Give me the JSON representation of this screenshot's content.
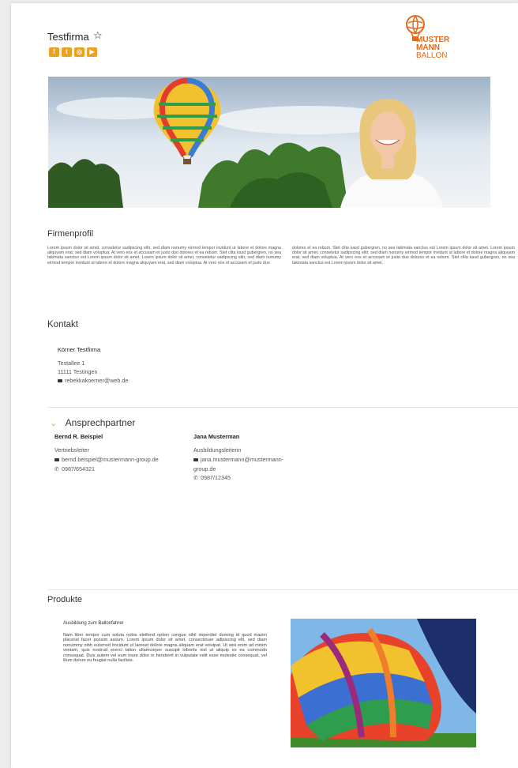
{
  "header": {
    "company_name": "Testfirma",
    "star_icon": "star-outline-icon",
    "social_icons": [
      "facebook-icon",
      "twitter-icon",
      "instagram-icon",
      "youtube-icon"
    ],
    "logo": {
      "line1": "MUSTER",
      "line2": "MANN",
      "line3": "BALLON",
      "brand_color": "#e06b1c"
    }
  },
  "accent_color": "#f0a020",
  "profile": {
    "title": "Firmenprofil",
    "col1": "Lorem ipsum dolor sit amet, consetetur sadipscing elitr, sed diam nonumy eirmod tempor invidunt ut labore et dolore magna aliquyam erat, sed diam voluptua. At vero eos et accusam et justo duo dolores et ea rebum. Stet clita kasd gubergren, no sea takimata sanctus est Lorem ipsum dolor sit amet. Lorem ipsum dolor sit amet, consetetur sadipscing elitr, sed diam nonumy eirmod tempor invidunt ut labore et dolore magna aliquyam erat, sed diam voluptua. At vero eos et accusam et justo duo",
    "col2": "dolores et ea rebum. Stet clita kasd gubergren, no sea takimata sanctus est Lorem ipsum dolor sit amet. Lorem ipsum dolor sit amet, consetetur sadipscing elitr, sed diam nonumy eirmod tempor invidunt ut labore et dolore magna aliquyam erat, sed diam voluptua. At vero eos et accusam et justo duo dolores et ea rebum. Stet clita kasd gubergren, no sea takimata sanctus est Lorem ipsum dolor sit amet."
  },
  "kontakt": {
    "title": "Kontakt",
    "name": "Körner Testfirma",
    "street": "Testallee 1",
    "city": "11111 Testingen",
    "email": "rebekkakoerner@web.de"
  },
  "ansprechpartner": {
    "title": "Ansprechpartner",
    "persons": [
      {
        "name": "Bernd R. Beispiel",
        "role": "Vertriebsleiter",
        "email": "bernd.beispiel@mustermann-group.de",
        "phone": "0987/654321"
      },
      {
        "name": "Jana Musterman",
        "role": "Ausbildungsleiterin",
        "email_line1": "jana.mustermann@mustermann-",
        "email_line2": "group.de",
        "phone": "0987/12345"
      }
    ]
  },
  "produkte": {
    "title": "Produkte",
    "item_title": "Ausbildung zum Ballonfahrer",
    "item_text": "Nam liber tempor cum soluta nobis eleifend option congue nihil imperdiet doming id quod mazim placerat facer possim assum. Lorem ipsum dolor sit amet, consectetuer adipiscing elit, sed diam nonummy nibh euismod tincidunt ut laoreet dolore magna aliquam erat volutpat. Ut wisi enim ad minim veniam, quis nostrud exerci tation ullamcorper suscipit lobortis nisl ut aliquip ex ea commodo consequat. Duis autem vel eum iriure dolor in hendrerit in vulputate velit esse molestie consequat, vel illum dolore eu feugiat nulla facilisis."
  }
}
